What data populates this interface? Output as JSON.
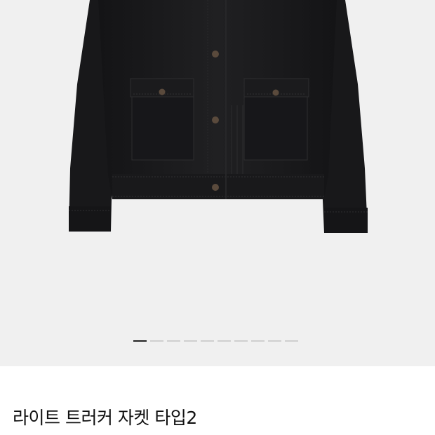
{
  "product": {
    "title": "라이트 트러커 자켓 타입2",
    "image_name": "black-trucker-jacket-photo"
  },
  "carousel": {
    "slide_count": 10,
    "active_index": 0
  },
  "colors": {
    "background": "#f0f0f0",
    "jacket": "#1a1a1c",
    "indicator_active": "#222222",
    "indicator_inactive": "#cfcfcf"
  }
}
